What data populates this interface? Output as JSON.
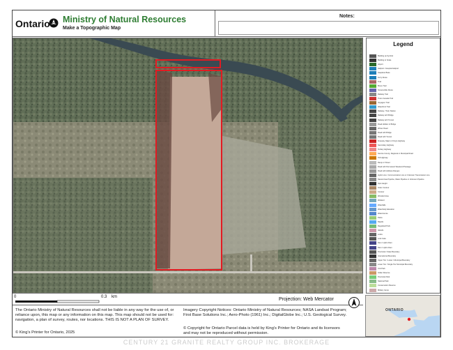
{
  "header": {
    "province": "Ontario",
    "ministry": "Ministry of Natural Resources",
    "subtitle": "Make a Topographic Map",
    "notes_label": "Notes:"
  },
  "legend": {
    "title": "Legend",
    "items": [
      "Building as Symbol",
      "Building to Scale",
      "Airport",
      "Heliport / Hospital Heliport",
      "Seaplane Base",
      "Ferry Route",
      "Trail",
      "Bruce Trail",
      "Snowmobile Route",
      "Railway Trail",
      "Trans Canada Trail",
      "Voyageur Trail",
      "Waterfront Trail",
      "Railway / Train Station",
      "Railway with Bridge",
      "Railway with Tunnel",
      "Road Hidden in Bridge",
      "Winter Road",
      "Road with Bridge",
      "Road with Tunnel",
      "Freeway, Major or King's Highway",
      "Secondary Highway",
      "Tertiary Highway",
      "Service County, Regional or Municipal Road",
      "Toll Highway",
      "Ramp or Street",
      "Road with Permanent Weekend Passage",
      "Road with Address Ranges",
      "Hydro Line / Communication Line or Unknown Transmission Line",
      "Natural Gas Pipeline, Water Pipeline or Unknown Pipeline",
      "Spot Height",
      "Index Contour",
      "Contour",
      "Wooded Area",
      "Wetland",
      "Waterfalls",
      "Waterbody Elevation",
      "Watercourse",
      "Parks",
      "Rapids",
      "Regulated Park",
      "Islands",
      "Locks",
      "Lock Gate",
      "Dam / Hydro Dam",
      "Dam / Hydro Dam",
      "Provincial / State Boundary",
      "International Boundary",
      "Upper Tier / Lower / Municipal Boundary",
      "Lower Tier / Single Tier Municipal Boundary",
      "Unit Park",
      "Indian Reserve",
      "Provincial Park",
      "National Park",
      "Conservation Reserve",
      "Military Camp"
    ]
  },
  "scale": {
    "zero": "0",
    "distance": "0.3",
    "unit": "km"
  },
  "projection": "Projection: Web Mercator",
  "disclaimer": "The Ontario Ministry of Natural Resources shall not be liable in any way for the use of, or reliance upon, this map or any information on this map.  This map should not be used for: navigation, a plan of survey, routes, nor locations. THIS IS NOT A PLAN OF SURVEY.",
  "copyright": "© King's Printer for Ontario, 2025",
  "imagery": "Imagery Copyright Notices: Ontario Ministry of Natural Resources; NASA Landsat Program; First Base Solutions Inc.; Aero-Photo (1961) Inc.; DigitalGlobe Inc.; U.S. Geological Survey.",
  "parcel": "© Copyright for Ontario Parcel data is held by King's Printer for Ontario and its licensors and may not be reproduced without permission.",
  "inset_label": "ONTARIO",
  "watermark": "CENTURY 21 GRANITE REALTY GROUP INC. BROKERAGE",
  "colors": {
    "parcel_outline": "#e21b22",
    "ministry_green": "#2e7d32",
    "river": "#3a4a52"
  }
}
